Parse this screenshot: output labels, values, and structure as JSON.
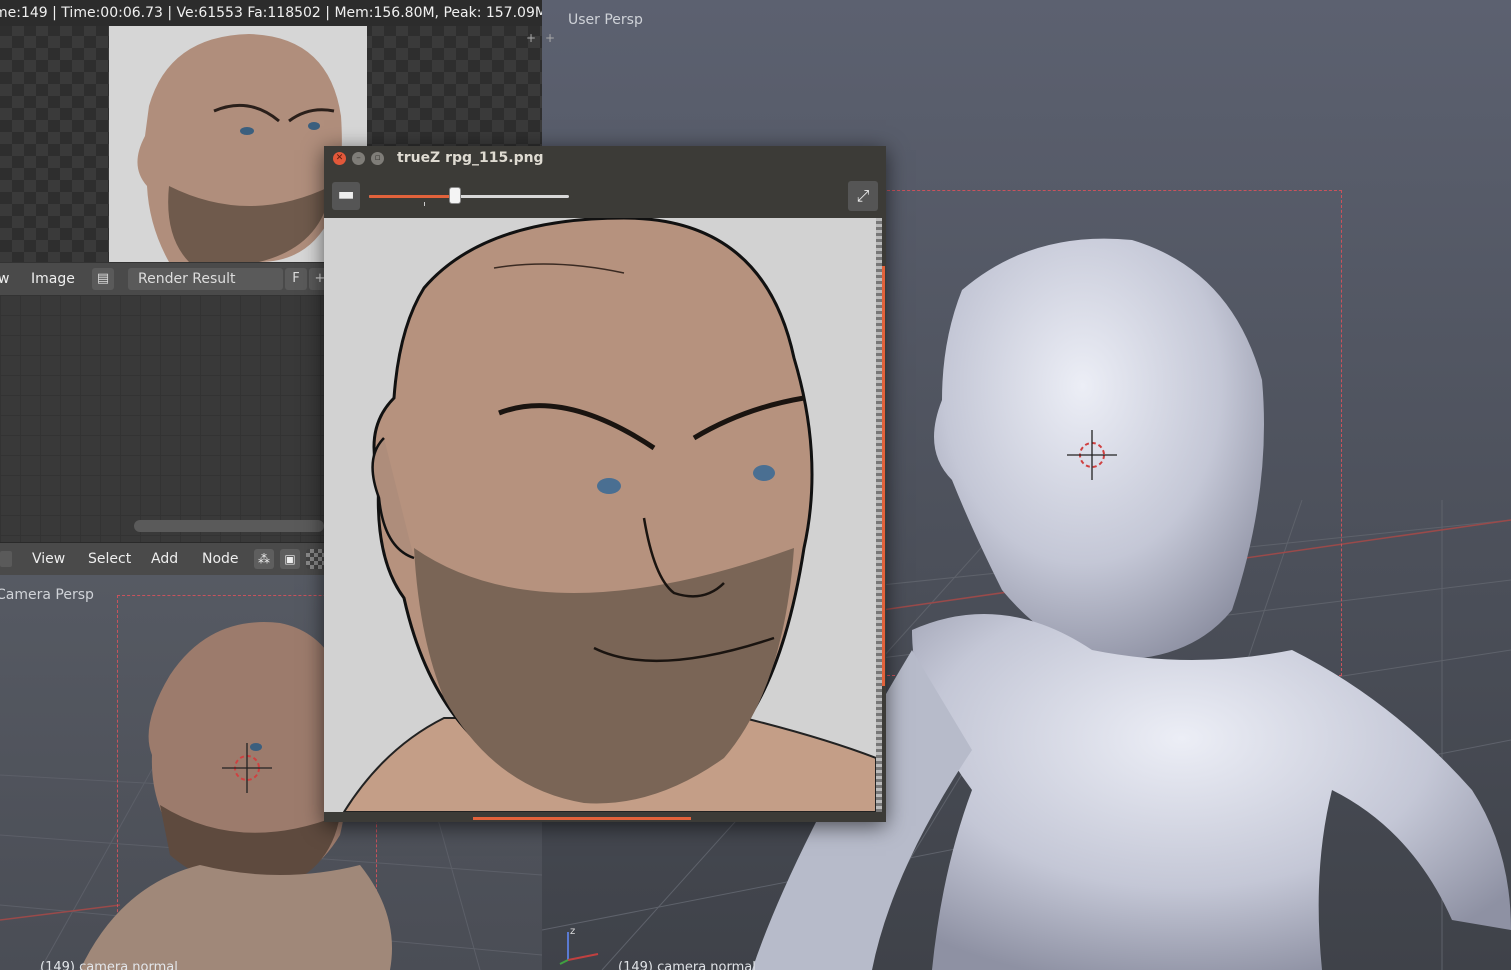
{
  "stats_bar": {
    "text": "me:149 | Time:00:06.73 | Ve:61553 Fa:118502 | Mem:156.80M, Peak: 157.09M"
  },
  "image_editor": {
    "menu_partial_view": "w",
    "menu_image": "Image",
    "image_name": "Render Result",
    "fake_user_label": "F",
    "add_label": "+"
  },
  "node_editor": {
    "menu_view": "View",
    "menu_select": "Select",
    "menu_add": "Add",
    "menu_node": "Node"
  },
  "camera_viewport": {
    "label": "Camera Persp",
    "status": "(149) camera normal"
  },
  "user_viewport": {
    "label": "User Persp",
    "status": "(149) camera normal"
  },
  "image_viewer": {
    "title": "trueZ rpg_115.png",
    "zoom_level": 0.43
  },
  "colors": {
    "accent": "#e2623b",
    "camera_frame": "#c9525c",
    "close_button": "#e2583a"
  },
  "icons": {
    "close": "close-icon",
    "minimize": "minimize-icon",
    "maximize": "maximize-icon",
    "zoom_out": "zoom-out-icon",
    "fullscreen": "fullscreen-icon",
    "image_type": "image-icon"
  }
}
